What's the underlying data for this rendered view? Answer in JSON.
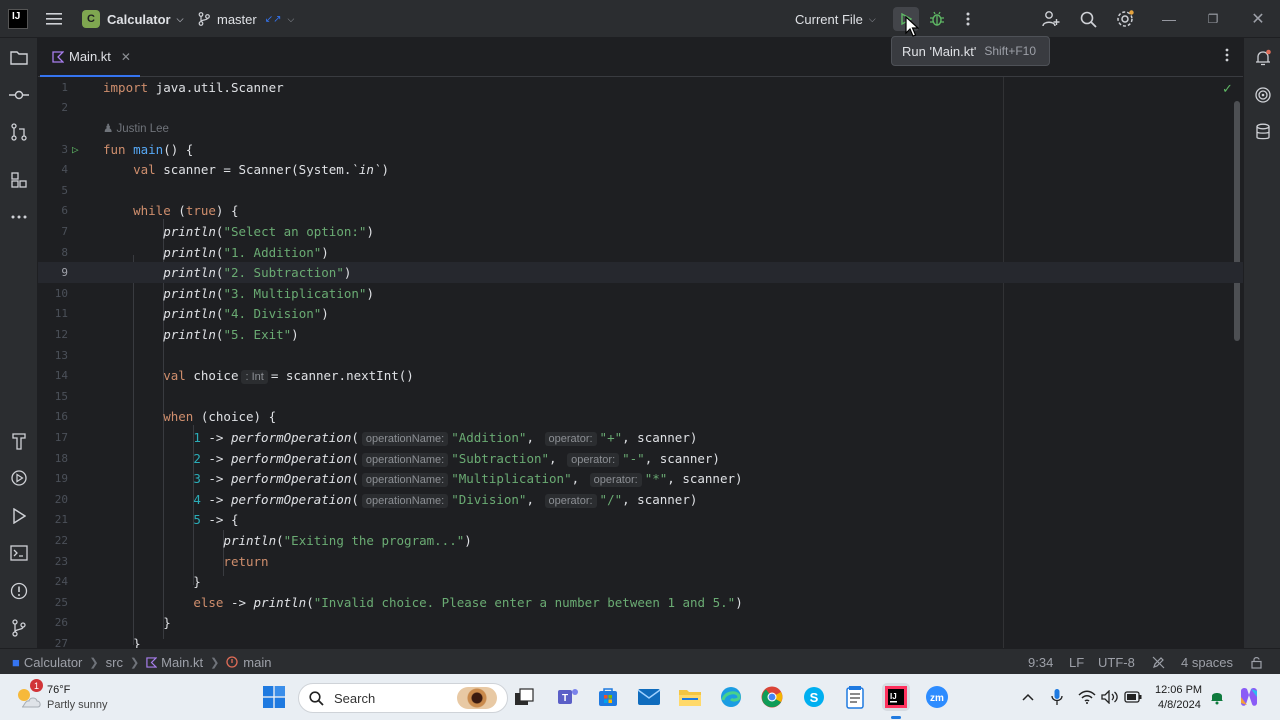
{
  "titlebar": {
    "logo_text": "IJ",
    "project_initial": "C",
    "project_name": "Calculator",
    "branch_name": "master",
    "run_config": "Current File",
    "icons": [
      "hamburger-menu-icon",
      "branch-icon",
      "run-icon",
      "debug-icon",
      "more-vertical-icon",
      "add-user-icon",
      "search-icon",
      "settings-icon",
      "minimize-icon",
      "maximize-icon",
      "close-icon"
    ]
  },
  "tooltip": {
    "label": "Run 'Main.kt'",
    "shortcut": "Shift+F10"
  },
  "tabs": [
    {
      "label": "Main.kt",
      "active": true
    }
  ],
  "editor": {
    "author": "Justin Lee",
    "current_line": 9,
    "lines": [
      "1",
      "2",
      "3",
      "4",
      "5",
      "6",
      "7",
      "8",
      "9",
      "10",
      "11",
      "12",
      "13",
      "14",
      "15",
      "16",
      "17",
      "18",
      "19",
      "20",
      "21",
      "22",
      "23",
      "24",
      "25",
      "26",
      "27"
    ],
    "hints": {
      "int_type": ": Int",
      "operation_name": "operationName:",
      "operator": "operator:"
    },
    "strings": {
      "import_path": "java.util.Scanner",
      "println1": "\"Select an option:\"",
      "println2": "\"1. Addition\"",
      "println3": "\"2. Subtraction\"",
      "println4": "\"3. Multiplication\"",
      "println5": "\"4. Division\"",
      "println6": "\"5. Exit\"",
      "op_add": "\"Addition\"",
      "op_sub": "\"Subtraction\"",
      "op_mul": "\"Multiplication\"",
      "op_div": "\"Division\"",
      "sym_add": "\"+\"",
      "sym_sub": "\"-\"",
      "sym_mul": "\"*\"",
      "sym_div": "\"/\"",
      "exiting": "\"Exiting the program...\"",
      "invalid": "\"Invalid choice. Please enter a number between 1 and 5.\""
    }
  },
  "statusbar": {
    "breadcrumb": [
      "Calculator",
      "src",
      "Main.kt",
      "main"
    ],
    "position": "9:34",
    "line_ending": "LF",
    "encoding": "UTF-8",
    "indent": "4 spaces"
  },
  "taskbar": {
    "weather_badge": "1",
    "temperature": "76°F",
    "weather": "Partly sunny",
    "search_placeholder": "Search",
    "time": "12:06 PM",
    "date": "4/8/2024",
    "apps": [
      "windows-start-icon",
      "task-view-icon",
      "teams-icon",
      "store-icon",
      "mail-icon",
      "file-explorer-icon",
      "edge-icon",
      "chrome-icon",
      "skype-icon",
      "notepad-icon",
      "intellij-icon",
      "zoom-icon"
    ]
  }
}
